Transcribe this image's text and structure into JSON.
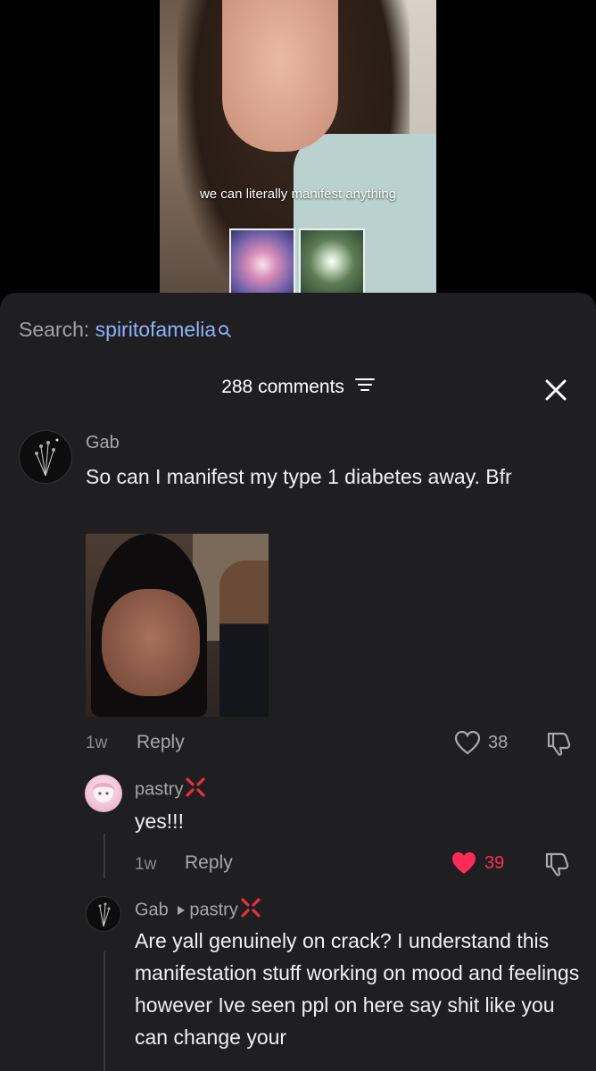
{
  "video": {
    "caption": "we can literally manifest anything"
  },
  "search": {
    "label": "Search:",
    "query": "spiritofamelia"
  },
  "comments_header": {
    "count_label": "288 comments"
  },
  "comments": [
    {
      "username": "Gab",
      "text": "So can I manifest my type 1 diabetes away. Bfr",
      "time": "1w",
      "reply_label": "Reply",
      "likes": "38"
    },
    {
      "username": "pastry",
      "text": "yes!!!",
      "time": "1w",
      "reply_label": "Reply",
      "likes": "39"
    },
    {
      "username": "Gab",
      "reply_to": "pastry",
      "text": "Are yall genuinely on crack? I understand this manifestation stuff working on mood and feelings however Ive seen ppl on here say shit like you can change your"
    }
  ],
  "colors": {
    "sheet_bg": "#1f1f21",
    "link_blue": "#8ab4f8",
    "like_red": "#fe2c55",
    "anger_red": "#e8303a"
  },
  "icons": {
    "search": "magnifier-icon",
    "filter": "filter-lines-icon",
    "close": "x-icon",
    "like": "heart-icon",
    "dislike": "thumbs-down-icon",
    "anger": "anger-symbol-icon",
    "triangle": "right-triangle-icon"
  }
}
